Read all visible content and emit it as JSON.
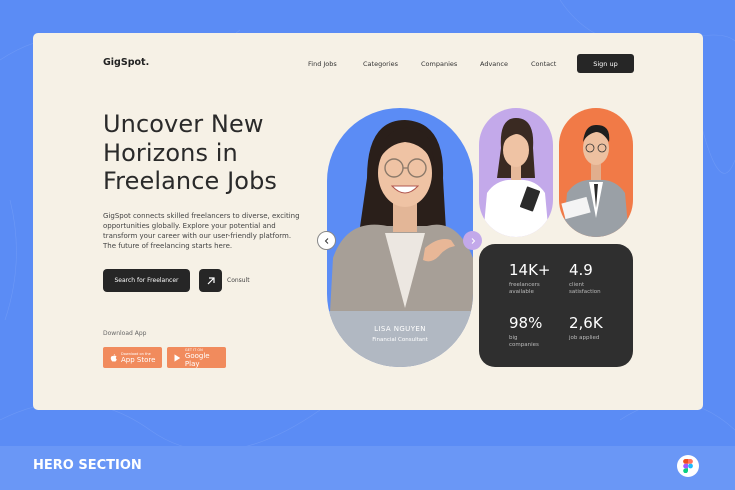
{
  "logo": "GigSpot.",
  "nav": [
    "Find Jobs",
    "Categories",
    "Companies",
    "Advance",
    "Contact"
  ],
  "signup_label": "Sign up",
  "hero": {
    "title": "Uncover New Horizons in Freelance Jobs",
    "description": "GigSpot connects skilled freelancers to diverse, exciting opportunities globally. Explore your potential and transform your career with our user-friendly platform. The future of freelancing starts here.",
    "search_label": "Search for Freelancer",
    "consult_label": "Consult"
  },
  "download": {
    "label": "Download App",
    "appstore_small": "Download on the",
    "appstore_big": "App Store",
    "googleplay_small": "GET IT ON",
    "googleplay_big": "Google Play"
  },
  "featured": {
    "name": "LISA NGUYEN",
    "role": "Financial Consultant"
  },
  "stats": [
    {
      "value": "14K+",
      "label": "freelancers available"
    },
    {
      "value": "4.9",
      "label": "client satisfaction"
    },
    {
      "value": "98%",
      "label": "big companies"
    },
    {
      "value": "2,6K",
      "label": "job applied"
    }
  ],
  "footer_title": "HERO SECTION",
  "colors": {
    "background": "#5b8cf5",
    "card": "#f6f1e6",
    "dark": "#262626",
    "accent_orange": "#f18b5d",
    "accent_purple": "#c3a9ea"
  },
  "icons": [
    "arrow-up-right-icon",
    "apple-icon",
    "google-play-icon",
    "chevron-left-icon",
    "chevron-right-icon",
    "figma-icon"
  ]
}
